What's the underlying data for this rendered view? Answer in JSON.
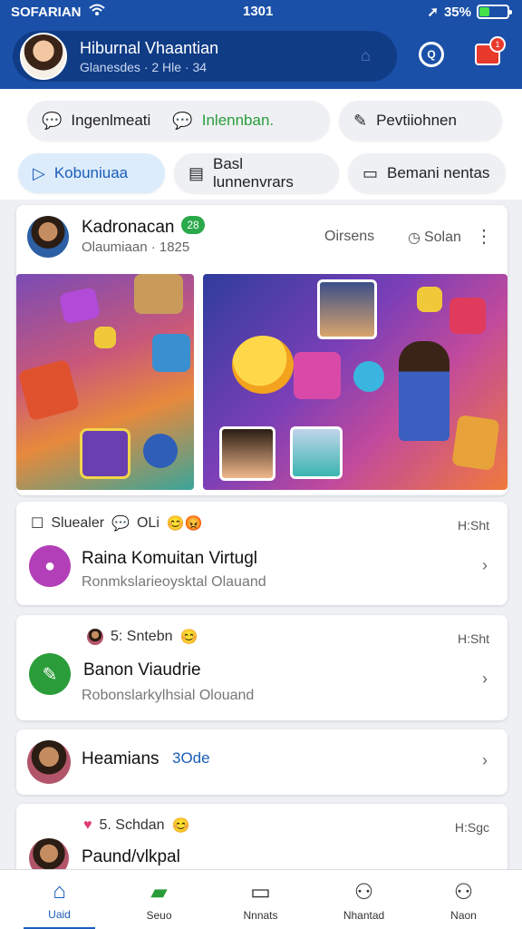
{
  "status_bar": {
    "carrier": "SOFARIAN",
    "time": "1301",
    "battery": "35%",
    "battery_level": 0.35
  },
  "header": {
    "profile_name": "Hiburnal Vhaantian",
    "profile_sub": "Glanesdes · 2 Hle · 34",
    "mail_badge": "1"
  },
  "chips_row1": [
    {
      "label": "Ingenlmeati",
      "icon": "chat-bubble-icon"
    },
    {
      "label": "Inlennban.",
      "icon": "chat-bubble-icon"
    },
    {
      "label": "Pevtiiohnen",
      "icon": "pencil-icon"
    }
  ],
  "chips_row2": [
    {
      "label": "Kobuniuaa",
      "icon": "play-icon"
    },
    {
      "label": "Basl lunnenvrars",
      "icon": "document-icon"
    },
    {
      "label": "Bemani nentas",
      "icon": "window-icon"
    }
  ],
  "post": {
    "author": "Kadronacan",
    "badge": "28",
    "subtitle": "Olaumiaan · 1825",
    "action_1": "Oirsens",
    "action_2": "Solan"
  },
  "items": [
    {
      "meta": "Sluealer",
      "extra": "OLi",
      "time": "H:Sht",
      "title": "Raina Komuitan Virtugl",
      "sub": "Ronmkslarieoysktal Olauand"
    },
    {
      "meta": "5: Sntebn",
      "time": "H:Sht",
      "title": "Banon Viaudrie",
      "sub": "Robonslarkylhsial Olouand"
    },
    {
      "meta": "",
      "time": "",
      "title": "Heamians",
      "tag": "3Ode",
      "sub": ""
    },
    {
      "meta": "5. Schdan",
      "time": "H:Sgc",
      "title": "Paund/vlkpal",
      "sub": ""
    }
  ],
  "bottom_nav": [
    {
      "label": "Uaid",
      "icon": "home-icon",
      "active": true
    },
    {
      "label": "Seuo",
      "icon": "book-icon",
      "active": false
    },
    {
      "label": "Nnnats",
      "icon": "window-icon",
      "active": false
    },
    {
      "label": "Nhantad",
      "icon": "profile-icon",
      "active": false
    },
    {
      "label": "Naon",
      "icon": "profile-icon",
      "active": false
    }
  ],
  "colors": {
    "header": "#1a50a8",
    "accent": "#1b5db8",
    "green": "#2a9d3a"
  }
}
